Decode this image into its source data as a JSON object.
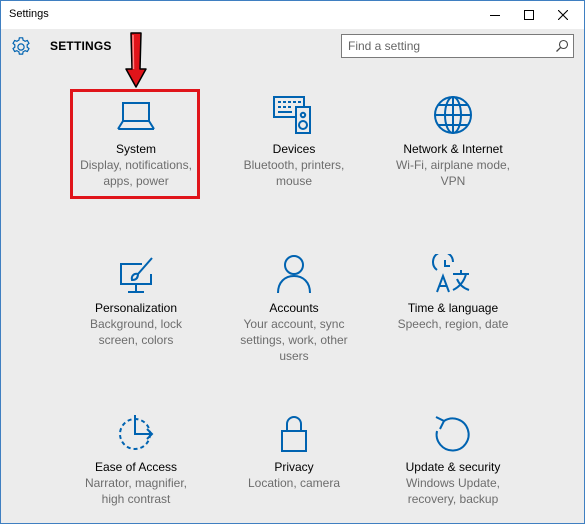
{
  "window": {
    "title": "Settings"
  },
  "header": {
    "title": "SETTINGS",
    "search_placeholder": "Find a setting"
  },
  "tiles": [
    {
      "name": "System",
      "desc": [
        "Display, notifications,",
        "apps, power"
      ],
      "icon": "laptop-icon"
    },
    {
      "name": "Devices",
      "desc": [
        "Bluetooth, printers,",
        "mouse"
      ],
      "icon": "keyboard-speaker-icon"
    },
    {
      "name": "Network & Internet",
      "desc": [
        "Wi-Fi, airplane mode,",
        "VPN"
      ],
      "icon": "globe-icon"
    },
    {
      "name": "Personalization",
      "desc": [
        "Background, lock",
        "screen, colors"
      ],
      "icon": "paintbrush-icon"
    },
    {
      "name": "Accounts",
      "desc": [
        "Your account, sync",
        "settings, work, other",
        "users"
      ],
      "icon": "person-icon"
    },
    {
      "name": "Time & language",
      "desc": [
        "Speech, region, date"
      ],
      "icon": "time-language-icon"
    },
    {
      "name": "Ease of Access",
      "desc": [
        "Narrator, magnifier,",
        "high contrast"
      ],
      "icon": "ease-of-access-icon"
    },
    {
      "name": "Privacy",
      "desc": [
        "Location, camera"
      ],
      "icon": "lock-icon"
    },
    {
      "name": "Update & security",
      "desc": [
        "Windows Update,",
        "recovery, backup"
      ],
      "icon": "refresh-icon"
    }
  ],
  "colors": {
    "accent": "#0063b1",
    "highlight": "#e0141a",
    "background": "#ececec"
  }
}
